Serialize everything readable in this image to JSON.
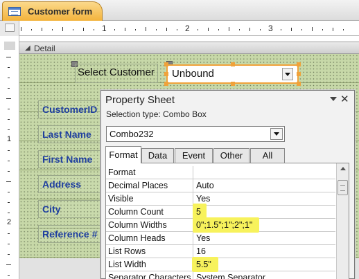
{
  "tab": {
    "title": "Customer form",
    "icon": "form-icon"
  },
  "ruler": {
    "h_numbers": [
      "1",
      "2",
      "3"
    ],
    "v_numbers": [
      "1",
      "2"
    ]
  },
  "section": {
    "label": "Detail"
  },
  "form": {
    "select_label": "Select Customer",
    "combo_value": "Unbound",
    "fields": [
      "CustomerID",
      "Last Name",
      "First Name",
      "Address",
      "City",
      "Reference #"
    ]
  },
  "property_sheet": {
    "title": "Property Sheet",
    "close_glyph": "✕",
    "selection_type": "Selection type:  Combo Box",
    "control_name": "Combo232",
    "tabs": [
      {
        "label": "Format",
        "active": true
      },
      {
        "label": "Data",
        "active": false
      },
      {
        "label": "Event",
        "active": false
      },
      {
        "label": "Other",
        "active": false
      },
      {
        "label": "All",
        "active": false
      }
    ],
    "rows": [
      {
        "name": "Format",
        "value": ""
      },
      {
        "name": "Decimal Places",
        "value": "Auto"
      },
      {
        "name": "Visible",
        "value": "Yes"
      },
      {
        "name": "Column Count",
        "value": "5",
        "highlight": true
      },
      {
        "name": "Column Widths",
        "value": "0\";1.5\";1\";2\";1\"",
        "highlight": true
      },
      {
        "name": "Column Heads",
        "value": "Yes"
      },
      {
        "name": "List Rows",
        "value": "16"
      },
      {
        "name": "List Width",
        "value": "5.5\"",
        "highlight": true
      },
      {
        "name": "Separator Characters",
        "value": "System Separator"
      }
    ]
  },
  "colors": {
    "grid": "#c7d8a8",
    "highlight": "#f7f25c",
    "selection": "#f0a23a",
    "field_text": "#1f3f9f",
    "tab": "#f3b33c"
  }
}
